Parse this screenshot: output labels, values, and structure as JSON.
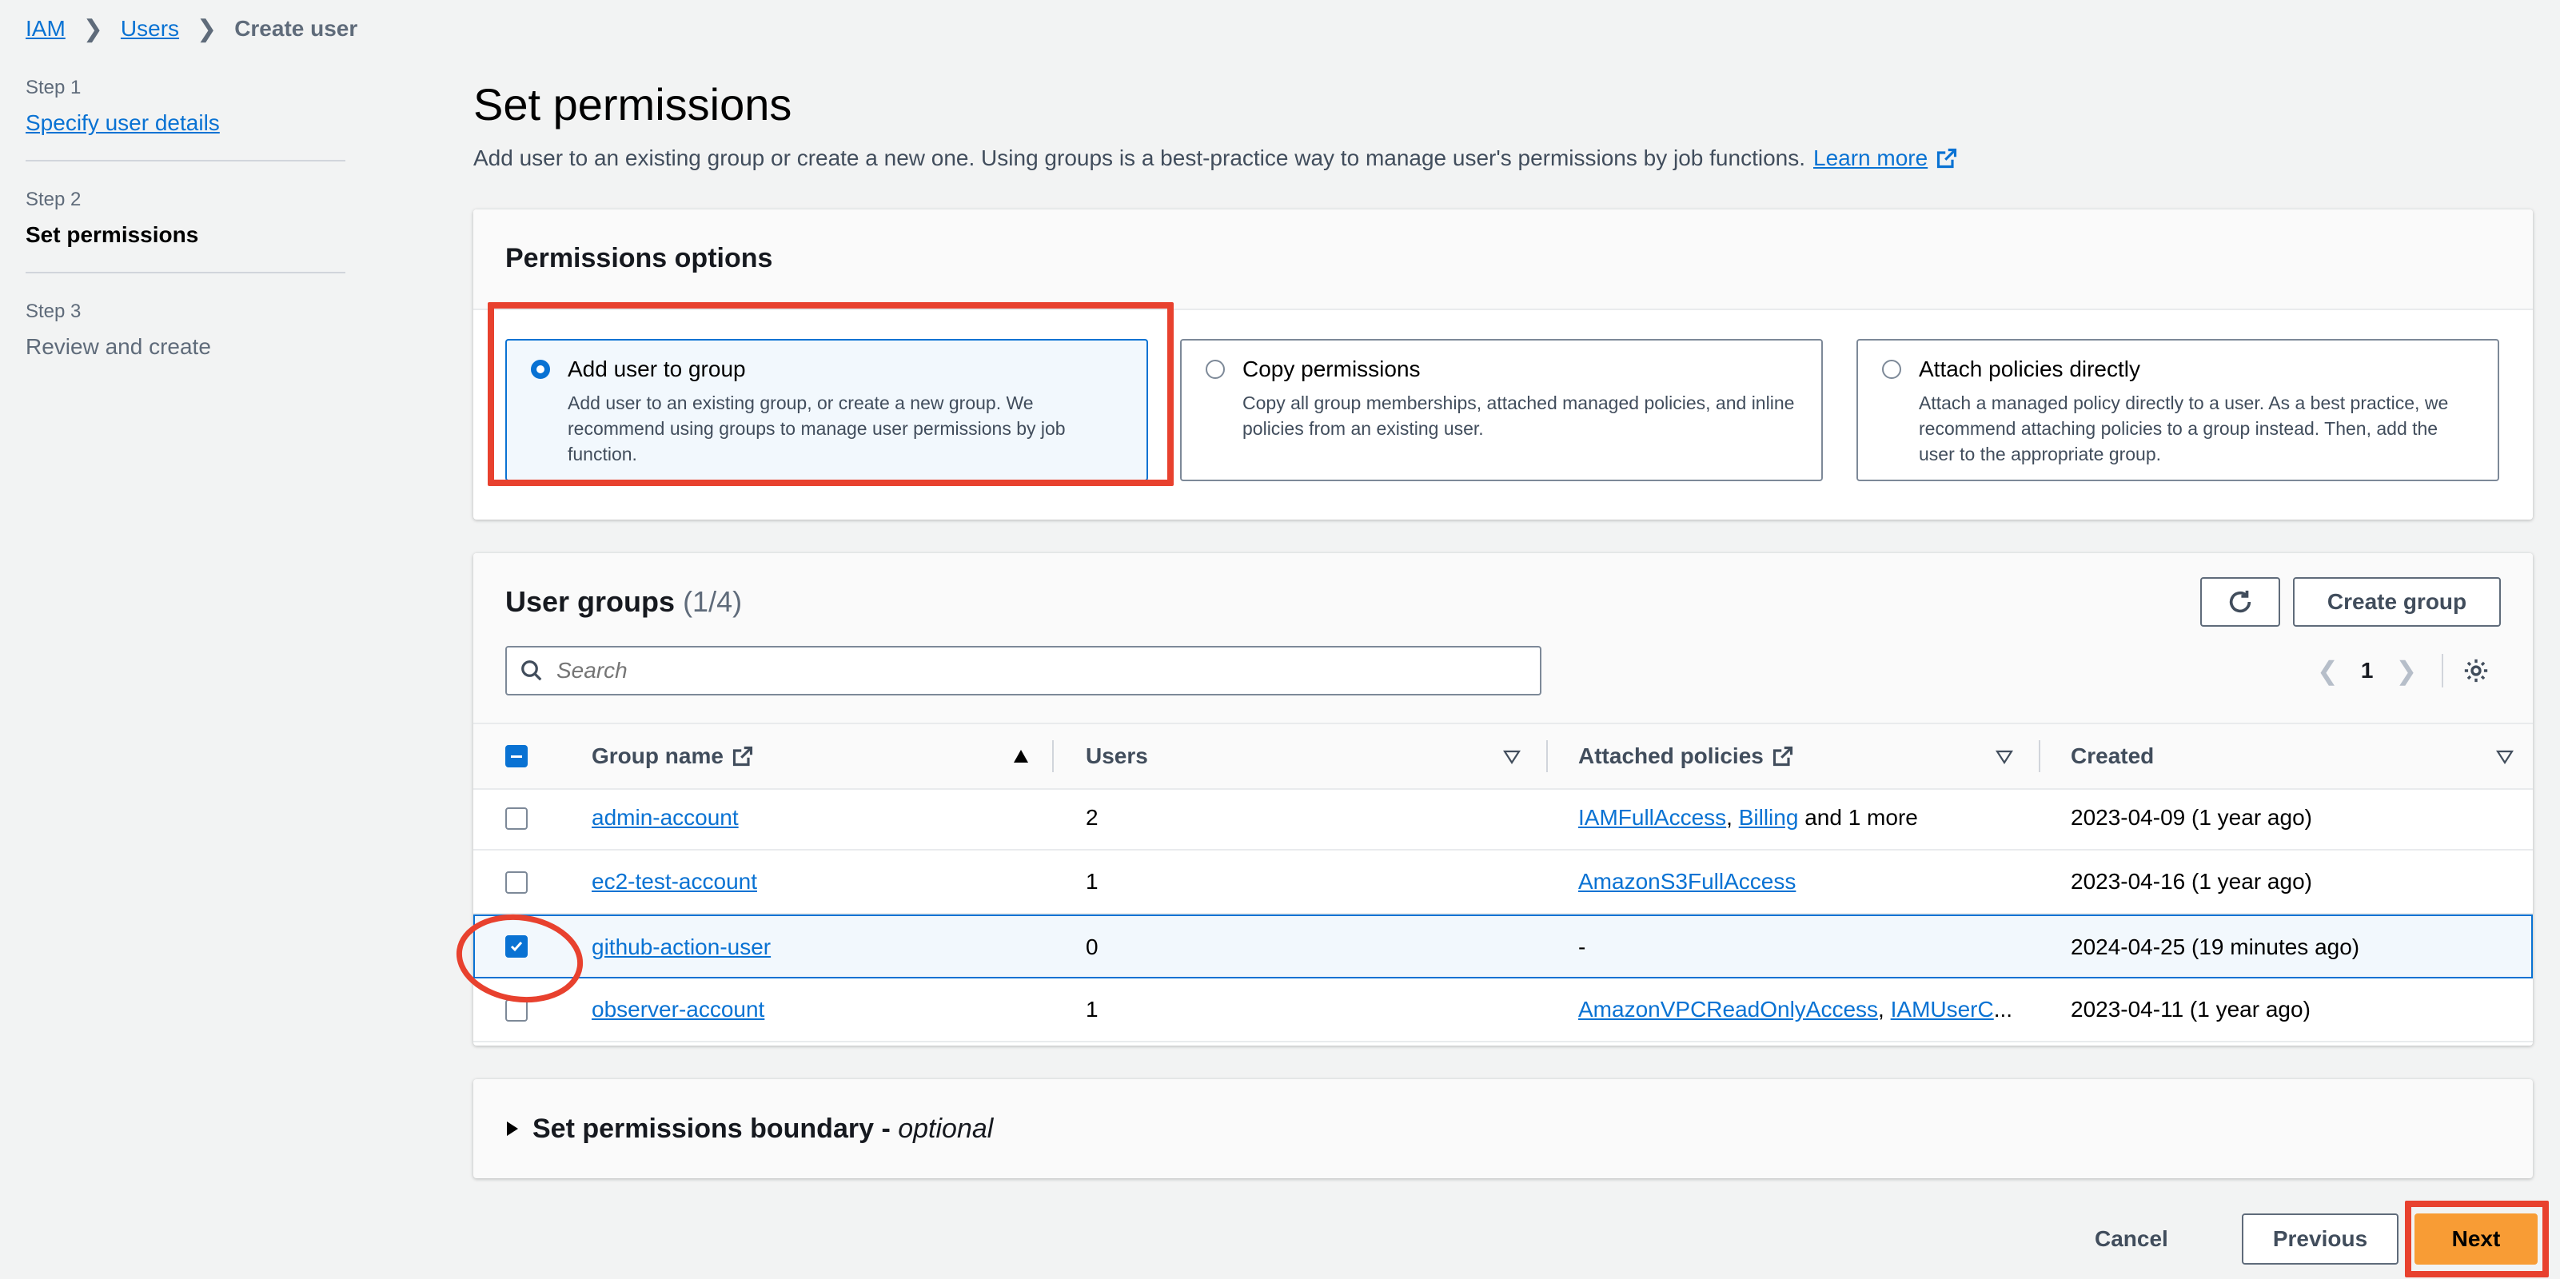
{
  "breadcrumb": {
    "iam": "IAM",
    "users": "Users",
    "current": "Create user"
  },
  "steps": [
    {
      "num": "Step 1",
      "title": "Specify user details"
    },
    {
      "num": "Step 2",
      "title": "Set permissions"
    },
    {
      "num": "Step 3",
      "title": "Review and create"
    }
  ],
  "page": {
    "title": "Set permissions",
    "description": "Add user to an existing group or create a new one. Using groups is a best-practice way to manage user's permissions by job functions.",
    "learn_more": "Learn more"
  },
  "permissions": {
    "title": "Permissions options",
    "options": [
      {
        "title": "Add user to group",
        "desc": "Add user to an existing group, or create a new group. We recommend using groups to manage user permissions by job function.",
        "selected": true
      },
      {
        "title": "Copy permissions",
        "desc": "Copy all group memberships, attached managed policies, and inline policies from an existing user.",
        "selected": false
      },
      {
        "title": "Attach policies directly",
        "desc": "Attach a managed policy directly to a user. As a best practice, we recommend attaching policies to a group instead. Then, add the user to the appropriate group.",
        "selected": false
      }
    ]
  },
  "groups": {
    "title": "User groups",
    "count": "(1/4)",
    "create_group": "Create group",
    "search_placeholder": "Search",
    "page": "1",
    "columns": {
      "name": "Group name",
      "users": "Users",
      "policies": "Attached policies",
      "created": "Created"
    },
    "rows": [
      {
        "name": "admin-account",
        "users": "2",
        "policy1": "IAMFullAccess",
        "sep": ", ",
        "policy2": "Billing",
        "extra": " and 1 more",
        "created": "2023-04-09 (1 year ago)",
        "checked": false
      },
      {
        "name": "ec2-test-account",
        "users": "1",
        "policy1": "AmazonS3FullAccess",
        "sep": "",
        "policy2": "",
        "extra": "",
        "created": "2023-04-16 (1 year ago)",
        "checked": false
      },
      {
        "name": "github-action-user",
        "users": "0",
        "policy1": "",
        "sep": "",
        "policy2": "",
        "extra": "-",
        "created": "2024-04-25 (19 minutes ago)",
        "checked": true
      },
      {
        "name": "observer-account",
        "users": "1",
        "policy1": "AmazonVPCReadOnlyAccess",
        "sep": ", ",
        "policy2": "IAMUserC",
        "extra": "...",
        "created": "2023-04-11 (1 year ago)",
        "checked": false
      }
    ]
  },
  "boundary": {
    "title": "Set permissions boundary - ",
    "optional": "optional"
  },
  "footer": {
    "cancel": "Cancel",
    "previous": "Previous",
    "next": "Next"
  },
  "colors": {
    "link": "#0972d3",
    "primary_button": "#f89c35",
    "annotation": "#e8412e"
  }
}
